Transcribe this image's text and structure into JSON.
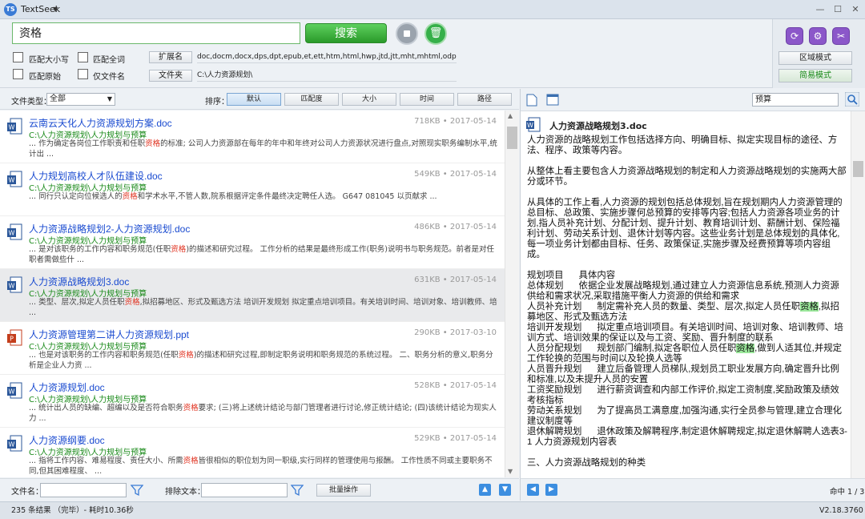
{
  "app": {
    "title": "TextSeek",
    "version": "V2.18.3760"
  },
  "window": {
    "minimize": "—",
    "maximize": "☐",
    "close": "✕"
  },
  "search": {
    "query": "资格",
    "button": "搜索"
  },
  "options": {
    "match_case": "匹配大小写",
    "match_whole": "匹配全词",
    "match_original": "匹配原始",
    "filename_only": "仅文件名"
  },
  "fields": {
    "ext_label": "扩展名",
    "ext_value": "doc,docm,docx,dps,dpt,epub,et,ett,htm,html,hwp,jtd,jtt,mht,mhtml,odp,ods,odt,ofd,",
    "folder_label": "文件夹",
    "folder_value": "C:\\人力资源规划\\"
  },
  "modes": {
    "region": "区域模式",
    "simple": "简易模式"
  },
  "filter": {
    "label": "文件类型：",
    "value": "全部"
  },
  "sort": {
    "label": "排序：",
    "buttons": [
      "默认",
      "匹配度",
      "大小",
      "时间",
      "路径"
    ]
  },
  "results": [
    {
      "title": "云南云天化人力资源规划方案.doc",
      "meta": "718KB • 2017-05-14",
      "path": "C:\\人力资源规划\\人力规划与预算",
      "snip_a": "... 作为确定各岗位工作职责和任职",
      "snip_hl": "资格",
      "snip_b": "的标准; 公司人力资源部在每年的年中和年终对公司人力资源状况进行盘点,对照现实职务编制水平,统计出 ...",
      "type": "doc"
    },
    {
      "title": "人力规划高校人才队伍建设.doc",
      "meta": "549KB • 2017-05-14",
      "path": "C:\\人力资源规划\\人力规划与预算",
      "snip_a": "... 同行只认定向位候选人的",
      "snip_hl": "资格",
      "snip_b": "和学术水平,不管人数,院系根据评定条件最终决定聘任人选。 G647 081045 以页献求 ...",
      "type": "doc"
    },
    {
      "title": "人力资源战略规划2-人力资源规划.doc",
      "meta": "486KB • 2017-05-14",
      "path": "C:\\人力资源规划\\人力规划与预算",
      "snip_a": "... 是对该职务的工作内容和职务规范(任职",
      "snip_hl": "资格",
      "snip_b": ")的描述和研究过程。 工作分析的结果是最终形成工作(职务)说明书与职务规范。前者是对任职者需做些什 ...",
      "type": "doc"
    },
    {
      "title": "人力资源战略规划3.doc",
      "meta": "631KB • 2017-05-14",
      "path": "C:\\人力资源规划\\人力规划与预算",
      "snip_a": "... 类型、层次,拟定人员任职",
      "snip_hl": "资格",
      "snip_b": ",拟招募地区、形式及甄选方法 培训开发规划 拟定重点培训项目。有关培训时间、培训对象、培训教师、培 ...",
      "type": "doc"
    },
    {
      "title": "人力资源管理第二讲人力资源规划.ppt",
      "meta": "290KB • 2017-03-10",
      "path": "C:\\人力资源规划\\人力规划与预算",
      "snip_a": "... 也是对该职务的工作内容和职务规范(任职",
      "snip_hl": "资格",
      "snip_b": ")的描述和研究过程,即制定职务说明和职务规范的系统过程。 二、职务分析的意义,职务分析是企业人力资 ...",
      "type": "ppt"
    },
    {
      "title": "人力资源规划.doc",
      "meta": "528KB • 2017-05-14",
      "path": "C:\\人力资源规划\\人力规划与预算",
      "snip_a": "... 统计出人员的缺编、超编以及是否符合职务",
      "snip_hl": "资格",
      "snip_b": "要求; (三)将上述统计结论与部门管理者进行讨论,修正统计结论; (四)该统计结论为现实人力 ...",
      "type": "doc"
    },
    {
      "title": "人力资源纲要.doc",
      "meta": "529KB • 2017-05-14",
      "path": "C:\\人力资源规划\\人力规划与预算",
      "snip_a": "... 指将工作内容、难易程度、责任大小、所需",
      "snip_hl": "资格",
      "snip_b": "皆很相似的职位划为同一职级,实行同样的管理使用与报酬。 工作性质不同或主要职务不同,但其困难程度、 ...",
      "type": "doc"
    },
    {
      "title": "人力资源规划操作手册流程",
      "meta": "566KB • 2017-05-14",
      "path": "",
      "snip_a": "",
      "snip_hl": "",
      "snip_b": "",
      "type": "doc"
    }
  ],
  "bottom": {
    "filename_label": "文件名：",
    "exclude_label": "排除文本：",
    "batch": "批量操作"
  },
  "status": {
    "text": "235 条结果 （完毕）- 耗时10.36秒"
  },
  "preview": {
    "search": "预算",
    "title": "人力资源战略规划3.doc",
    "hits": "命中 1 / 3",
    "p1": "人力资源的战略规划工作包括选择方向、明确目标、拟定实现目标的途径、方法、程序、政策等内容。",
    "p2": "从整体上看主要包含人力资源战略规划的制定和人力资源战略规划的实施两大部分或环节。",
    "p3": "从具体的工作上看,人力资源的规划包括总体规划,旨在规划期内人力资源管理的总目标、总政策、实施步骤何总预算的安排等内容;包括人力资源各项业务的计划,指人员补充计划、分配计划、提升计划、教育培训计划、薪酬计划、保险福利计划、劳动关系计划、退休计划等内容。这些业务计划是总体规划的具体化,每一项业务计划都由目标、任务、政策保证,实施步骤及经费预算等项内容组成。",
    "t0": "规划项目      具体内容",
    "t1": "总体规划      依据企业发展战略规划,通过建立人力资源信息系统,预测人力资源供给和需求状况,采取措施平衡人力资源的供给和需求",
    "t2a": "人员补充计划      制定需补充人员的数量、类型、层次,拟定人员任职",
    "t2h": "资格",
    "t2b": ",拟招募地区、形式及甄选方法",
    "t3": "培训开发规划      拟定重点培训项目。有关培训时间、培训对象、培训教师、培训方式、培训效果的保证以及与工资、奖励、晋升制度的联系",
    "t4a": "人员分配规划      规划部门编制,拟定各职位人员任职",
    "t4h": "资格",
    "t4b": ",做到人适其位,并规定工作轮换的范围与时间以及轮换人选等",
    "t5": "人员晋升规划      建立后备管理人员梯队,规划员工职业发展方向,确定晋升比例和标准,以及未提升人员的安置",
    "t6": "工资奖励规划      进行薪资调查和内部工作评价,拟定工资制度,奖励政策及绩效考核指标",
    "t7": "劳动关系规划      为了提高员工满意度,加强沟通,实行全员参与管理,建立合理化建议制度等",
    "t8": "退休解聘规划      退休政策及解聘程序,制定退休解聘规定,拟定退休解聘人选表3-1 人力资源规划内容表",
    "p4": "三、人力资源战略规划的种类"
  }
}
